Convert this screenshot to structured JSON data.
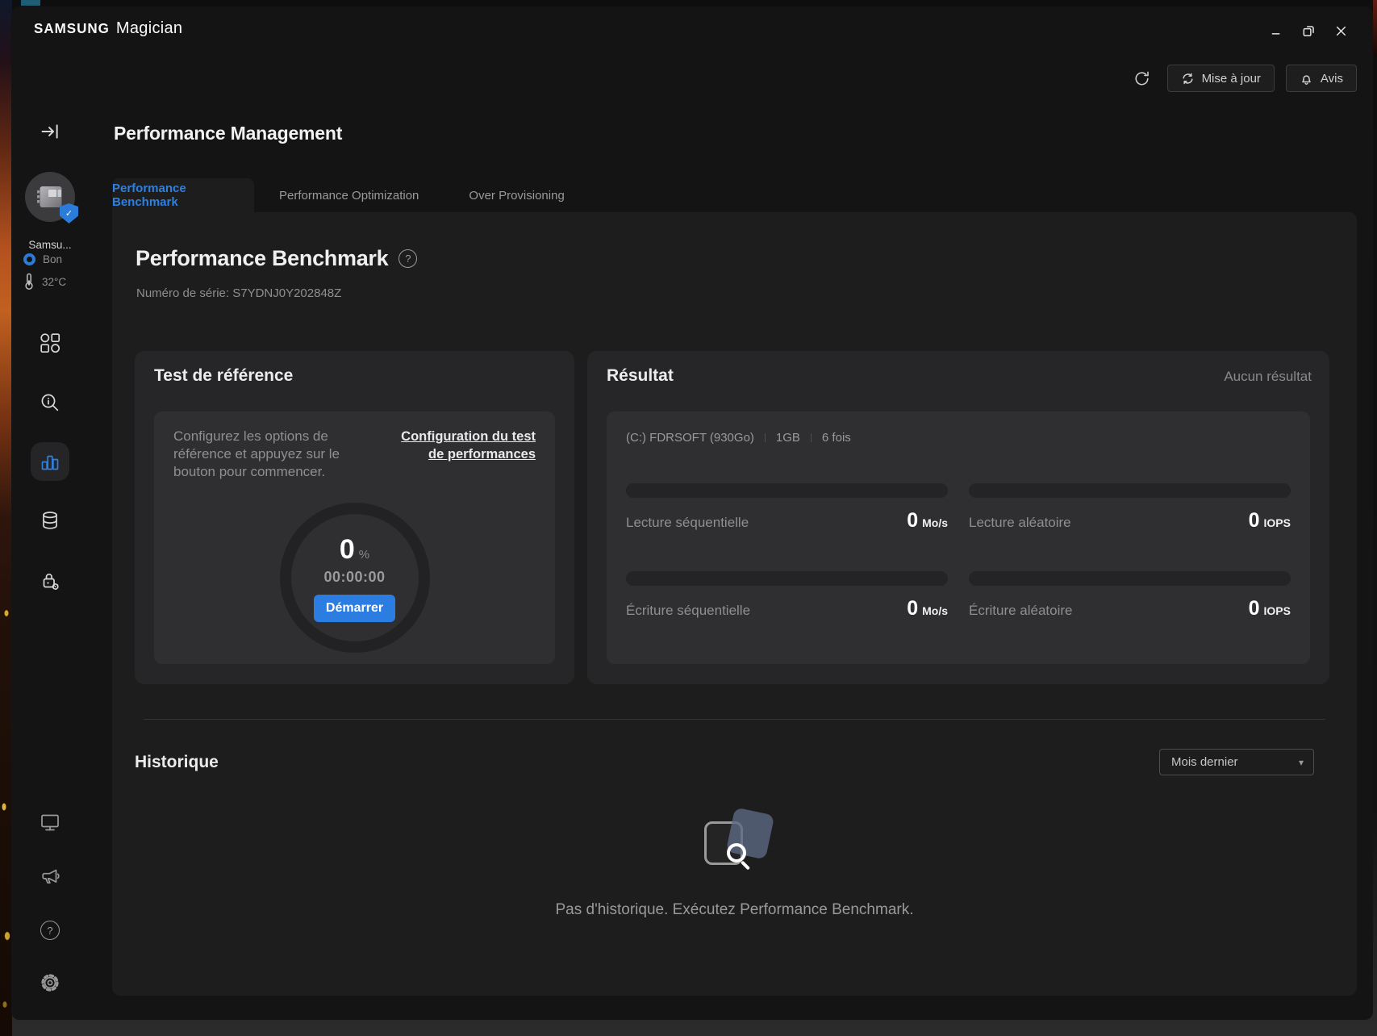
{
  "window": {
    "brand": "SAMSUNG",
    "app": "Magician"
  },
  "toolbar": {
    "update_label": "Mise à jour",
    "notice_label": "Avis"
  },
  "sidebar": {
    "device_name": "Samsu...",
    "status_label": "Bon",
    "temperature": "32°C"
  },
  "main": {
    "page_title": "Performance Management",
    "tabs": [
      {
        "label": "Performance Benchmark",
        "active": true
      },
      {
        "label": "Performance Optimization",
        "active": false
      },
      {
        "label": "Over Provisioning",
        "active": false
      }
    ],
    "benchmark": {
      "heading": "Performance Benchmark",
      "serial": "Numéro de série: S7YDNJ0Y202848Z"
    },
    "test_card": {
      "title": "Test de référence",
      "description": "Configurez les options de référence et appuyez sur le bouton pour commencer.",
      "config_link": "Configuration du test de performances",
      "progress_value": "0",
      "progress_unit": "%",
      "timer": "00:00:00",
      "start_label": "Démarrer"
    },
    "result_card": {
      "title": "Résultat",
      "empty_label": "Aucun résultat",
      "drive": "(C:) FDRSOFT (930Go)",
      "test_size": "1GB",
      "iterations": "6 fois",
      "metrics": [
        {
          "label": "Lecture séquentielle",
          "value": "0",
          "unit": "Mo/s"
        },
        {
          "label": "Lecture aléatoire",
          "value": "0",
          "unit": "IOPS"
        },
        {
          "label": "Écriture séquentielle",
          "value": "0",
          "unit": "Mo/s"
        },
        {
          "label": "Écriture aléatoire",
          "value": "0",
          "unit": "IOPS"
        }
      ]
    },
    "history": {
      "title": "Historique",
      "filter_value": "Mois dernier",
      "empty_message": "Pas d'historique. Exécutez Performance Benchmark."
    }
  },
  "icons": {
    "question": "?",
    "caret": "▾",
    "check": "✓"
  },
  "colors": {
    "accent_blue": "#2b7cd9",
    "window_bg": "#141414",
    "panel_bg": "#1d1d1e",
    "card_bg": "#262628",
    "inner_bg": "#2f2f31",
    "bar_bg": "#242426",
    "text_primary": "#ececec",
    "text_muted": "#8f8f8f"
  }
}
